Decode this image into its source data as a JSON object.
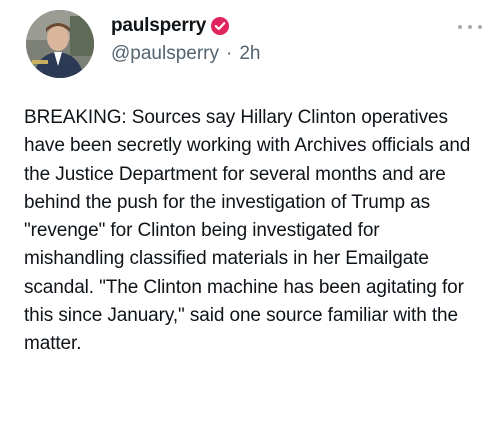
{
  "author": {
    "display_name": "paulsperry",
    "handle": "@paulsperry",
    "separator": "·",
    "timestamp": "2h",
    "verified_badge_color": "#e0245e",
    "avatar_icon": "avatar-photo"
  },
  "tweet": {
    "text": "BREAKING: Sources say Hillary Clinton operatives have been secretly working with Archives officials and the Justice Department for several months and are behind the push for the investigation of Trump as \"revenge\" for Clinton being investigated for mishandling classified materials in her Emailgate scandal. \"The Clinton machine has been agitating for this since January,\" said one source familiar with the matter."
  },
  "menu": {
    "icon": "more-options-icon"
  }
}
